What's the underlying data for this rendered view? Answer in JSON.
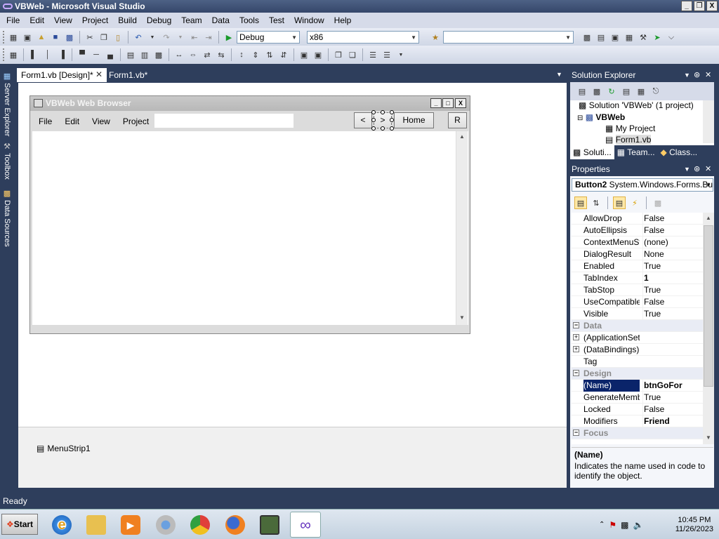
{
  "window": {
    "title": "VBWeb - Microsoft Visual Studio",
    "min": "_",
    "restore": "❐",
    "close": "X"
  },
  "menubar": [
    "File",
    "Edit",
    "View",
    "Project",
    "Build",
    "Debug",
    "Team",
    "Data",
    "Tools",
    "Test",
    "Window",
    "Help"
  ],
  "toolbar": {
    "config": "Debug",
    "platform": "x86",
    "find": ""
  },
  "side_tabs": [
    "Server Explorer",
    "Toolbox",
    "Data Sources"
  ],
  "doc_tabs": [
    "Form1.vb [Design]*",
    "Form1.vb*"
  ],
  "form": {
    "title": "VBWeb Web Browser",
    "menu": [
      "File",
      "Edit",
      "View",
      "Project"
    ],
    "back": "<",
    "forward": ">",
    "home": "Home",
    "refresh": "R",
    "url": ""
  },
  "tray": {
    "component": "MenuStrip1"
  },
  "solution_explorer": {
    "title": "Solution Explorer",
    "tree": [
      "Solution 'VBWeb' (1 project)",
      "VBWeb",
      "My Project",
      "Form1.vb"
    ],
    "tabs": [
      "Soluti...",
      "Team...",
      "Class..."
    ]
  },
  "properties": {
    "title": "Properties",
    "object": "Button2",
    "object_type": "System.Windows.Forms.But",
    "rows": [
      {
        "name": "AllowDrop",
        "value": "False"
      },
      {
        "name": "AutoEllipsis",
        "value": "False"
      },
      {
        "name": "ContextMenuStr",
        "value": "(none)"
      },
      {
        "name": "DialogResult",
        "value": "None"
      },
      {
        "name": "Enabled",
        "value": "True"
      },
      {
        "name": "TabIndex",
        "value": "1",
        "bold": true
      },
      {
        "name": "TabStop",
        "value": "True"
      },
      {
        "name": "UseCompatibleTe",
        "value": "False"
      },
      {
        "name": "Visible",
        "value": "True"
      },
      {
        "category": "Data"
      },
      {
        "name": "(ApplicationSetti",
        "value": "",
        "expand": true
      },
      {
        "name": "(DataBindings)",
        "value": "",
        "expand": true
      },
      {
        "name": "Tag",
        "value": ""
      },
      {
        "category": "Design"
      },
      {
        "name": "(Name)",
        "value": "btnGoFor",
        "selected": true,
        "bold": true
      },
      {
        "name": "GenerateMembe",
        "value": "True"
      },
      {
        "name": "Locked",
        "value": "False"
      },
      {
        "name": "Modifiers",
        "value": "Friend",
        "bold": true
      },
      {
        "category": "Focus"
      }
    ],
    "desc_title": "(Name)",
    "desc_text": "Indicates the name used in code to identify the object."
  },
  "status": "Ready",
  "clock": {
    "time": "10:45 PM",
    "date": "11/26/2023"
  },
  "start": "Start",
  "colors": {
    "chrome": "#2e3e5c",
    "selection": "#0a246a"
  }
}
